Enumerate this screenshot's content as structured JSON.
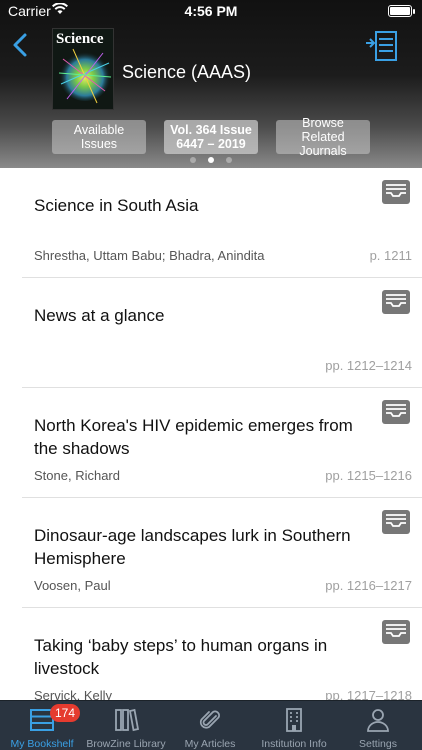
{
  "status_bar": {
    "carrier": "Carrier",
    "time": "4:56 PM"
  },
  "header": {
    "journal_title": "Science (AAAS)",
    "cover_text": "Science",
    "buttons": [
      {
        "label": "Available Issues",
        "selected": false
      },
      {
        "label": "Vol. 364 Issue 6447 – 2019",
        "selected": true
      },
      {
        "label": "Browse Related Journals",
        "selected": false
      }
    ],
    "page_indicator": {
      "count": 3,
      "active": 2
    }
  },
  "articles": [
    {
      "title": "Science in South Asia",
      "authors": "Shrestha, Uttam Babu; Bhadra, Anindita",
      "pages": "p. 1211"
    },
    {
      "title": "News at a glance",
      "authors": "",
      "pages": "pp. 1212–1214"
    },
    {
      "title": "North Korea's HIV epidemic emerges from the shadows",
      "authors": "Stone, Richard",
      "pages": "pp. 1215–1216"
    },
    {
      "title": "Dinosaur-age landscapes lurk in Southern Hemisphere",
      "authors": "Voosen, Paul",
      "pages": "pp. 1216–1217"
    },
    {
      "title": "Taking ‘baby steps’ to human organs in livestock",
      "authors": "Servick, Kelly",
      "pages": "pp. 1217–1218"
    }
  ],
  "tabbar": {
    "tabs": [
      {
        "label": "My Bookshelf",
        "icon": "bookshelf-icon",
        "active": true,
        "badge": "174"
      },
      {
        "label": "BrowZine Library",
        "icon": "library-icon",
        "active": false
      },
      {
        "label": "My Articles",
        "icon": "paperclip-icon",
        "active": false
      },
      {
        "label": "Institution Info",
        "icon": "building-icon",
        "active": false
      },
      {
        "label": "Settings",
        "icon": "person-icon",
        "active": false
      }
    ]
  },
  "colors": {
    "accent": "#3aa0e4",
    "tabbar_bg": "#2a3440",
    "badge": "#e53b2f"
  }
}
